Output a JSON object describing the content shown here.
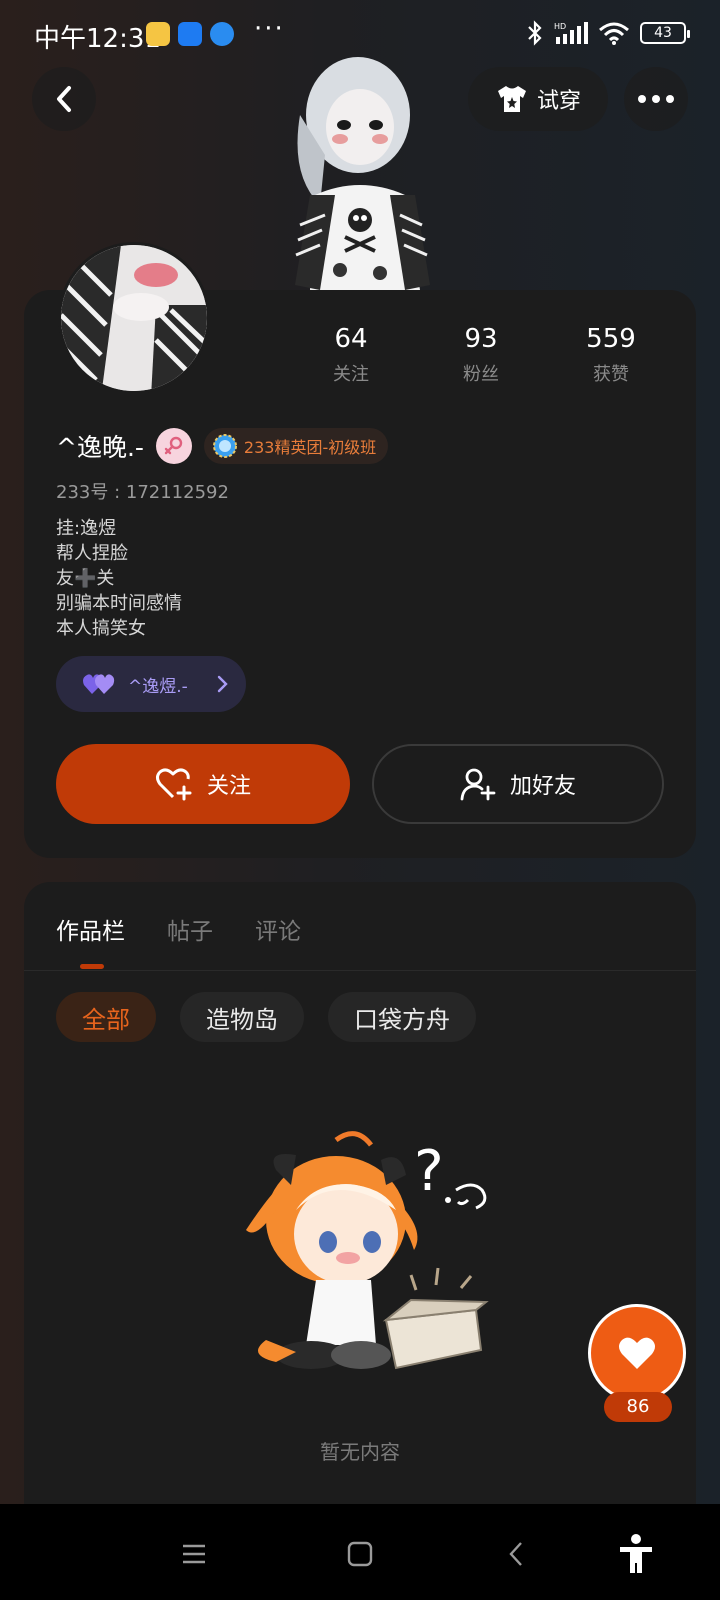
{
  "status_bar": {
    "time": "中午12:31",
    "battery": "43",
    "dots": "···"
  },
  "header": {
    "try_on_label": "试穿"
  },
  "profile": {
    "stats": [
      {
        "num": "64",
        "label": "关注"
      },
      {
        "num": "93",
        "label": "粉丝"
      },
      {
        "num": "559",
        "label": "获赞"
      }
    ],
    "username": "^逸晚.-",
    "rank_badge": "233精英团-初级班",
    "user_id": "233号 : 172112592",
    "bio": [
      "挂:逸煜",
      "帮人捏脸",
      "友➕关",
      "别骗本时间感情",
      "本人搞笑女"
    ],
    "linked_tag": "^逸煜.-",
    "follow_label": "关注",
    "add_friend_label": "加好友"
  },
  "works": {
    "tabs": [
      "作品栏",
      "帖子",
      "评论"
    ],
    "filters": [
      "全部",
      "造物岛",
      "口袋方舟"
    ],
    "empty_text": "暂无内容"
  },
  "like": {
    "count": "86"
  },
  "colors": {
    "accent": "#c03a07",
    "card": "#1c1c1c",
    "purple_tag": "#a99cf5"
  }
}
